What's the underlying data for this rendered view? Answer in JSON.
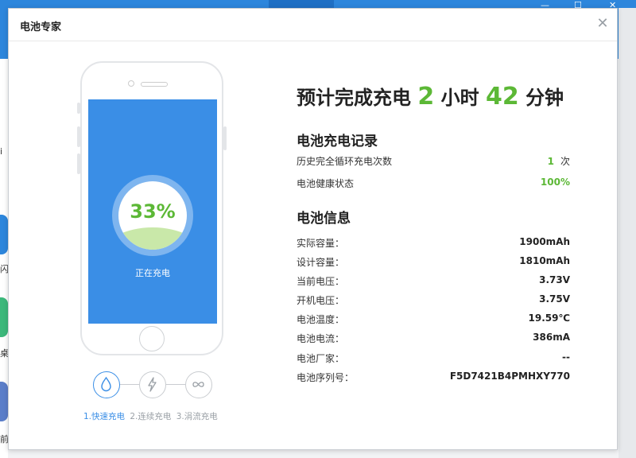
{
  "dialog": {
    "title": "电池专家"
  },
  "phone": {
    "percent": "33%",
    "percent_value": 33,
    "status": "正在充电"
  },
  "modes": [
    {
      "label": "1.快速充电",
      "icon": "drop-icon",
      "active": true
    },
    {
      "label": "2.连续充电",
      "icon": "bolt-icon",
      "active": false
    },
    {
      "label": "3.涓流充电",
      "icon": "infinity-icon",
      "active": false
    }
  ],
  "eta": {
    "prefix": "预计完成充电",
    "hours": "2",
    "hours_unit": "小时",
    "minutes": "42",
    "minutes_unit": "分钟"
  },
  "charge_record": {
    "title": "电池充电记录",
    "rows": [
      {
        "label": "历史完全循环充电次数",
        "value": "1",
        "unit": "次"
      },
      {
        "label": "电池健康状态",
        "value": "100%"
      }
    ]
  },
  "battery_info": {
    "title": "电池信息",
    "rows": [
      {
        "label": "实际容量：",
        "value": "1900mAh"
      },
      {
        "label": "设计容量：",
        "value": "1810mAh"
      },
      {
        "label": "当前电压：",
        "value": "3.73V"
      },
      {
        "label": "开机电压：",
        "value": "3.75V"
      },
      {
        "label": "电池温度：",
        "value": "19.59℃"
      },
      {
        "label": "电池电流：",
        "value": "386mA"
      },
      {
        "label": "电池厂家：",
        "value": "--"
      },
      {
        "label": "电池序列号：",
        "value": "F5D7421B4PMHXY770"
      }
    ]
  },
  "background_app": {
    "left_fragments": [
      "i",
      "闪",
      "桌",
      "前"
    ]
  },
  "colors": {
    "accent_blue": "#3a8ee6",
    "accent_green": "#5cb836",
    "topbar_blue": "#2d86dc"
  }
}
